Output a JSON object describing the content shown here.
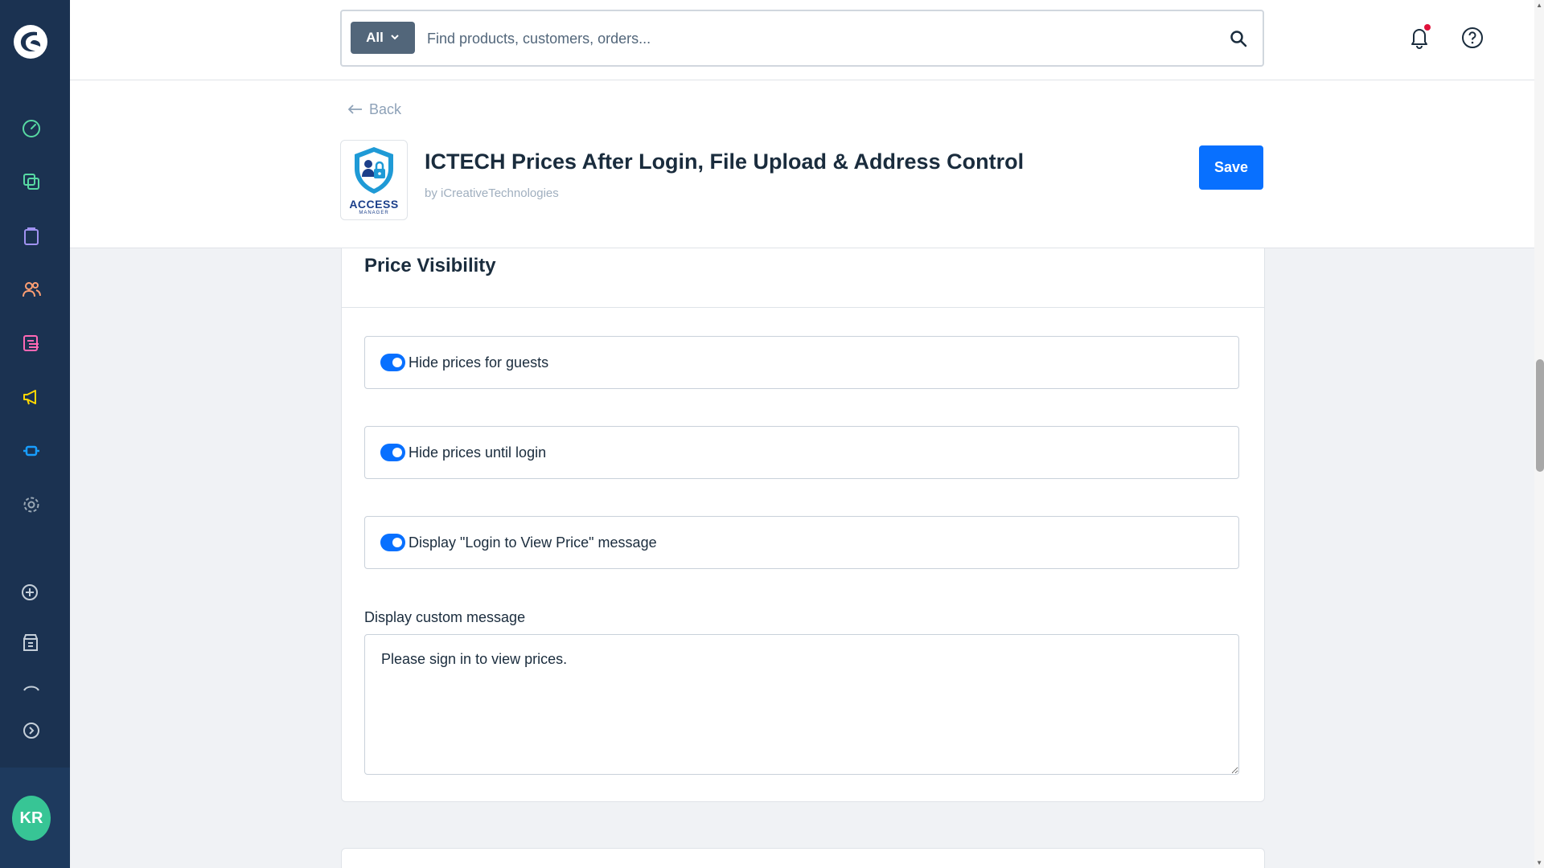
{
  "sidebar": {
    "avatar_initials": "KR",
    "nav_icons": [
      "dashboard-icon",
      "catalogs-icon",
      "orders-icon",
      "customers-icon",
      "content-icon",
      "marketing-icon",
      "extensions-icon",
      "settings-icon",
      "add-icon",
      "sales-channel-icon",
      "expand-icon"
    ]
  },
  "search": {
    "scope_label": "All",
    "placeholder": "Find products, customers, orders..."
  },
  "header": {
    "back_label": "Back",
    "app_title": "ICTECH Prices After Login, File Upload & Address Control",
    "app_author": "by iCreativeTechnologies",
    "logo_brand": "ACCESS",
    "logo_sub": "MANAGER",
    "save_label": "Save"
  },
  "section": {
    "title": "Price Visibility",
    "toggles": [
      {
        "label": "Hide prices for guests",
        "enabled": true
      },
      {
        "label": "Hide prices until login",
        "enabled": true
      },
      {
        "label": "Display \"Login to View Price\" message",
        "enabled": true
      }
    ],
    "custom_message_label": "Display custom message",
    "custom_message_value": "Please sign in to view prices."
  },
  "colors": {
    "sidebar": "#1b3251",
    "primary": "#0870ff",
    "avatar": "#37c595",
    "notification_dot": "#e0113b"
  }
}
